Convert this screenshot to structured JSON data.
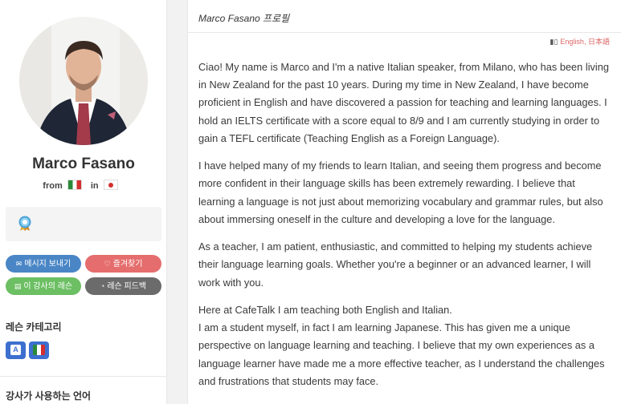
{
  "profile": {
    "name": "Marco Fasano",
    "from_label": "from",
    "in_label": "in",
    "from_flag": "italy-flag",
    "in_flag": "japan-flag"
  },
  "buttons": {
    "message": "메시지 보내기",
    "favorite": "즐겨찾기",
    "lessons": "이 강사의 레슨",
    "feedback": "레슨 피드백"
  },
  "sidebar": {
    "category_heading": "레슨 카테고리",
    "languages_heading": "강사가 사용하는 언어",
    "category_icons": [
      "english-category-icon",
      "italian-category-icon"
    ],
    "english_glyph": "A"
  },
  "main": {
    "title": "Marco Fasano 프로필",
    "language_links": [
      "English",
      "日本語"
    ],
    "language_separator": ",",
    "paragraphs": [
      "Ciao! My name is Marco and I'm a native Italian speaker, from Milano, who has been living in New Zealand for the past 10 years. During my time in New Zealand, I have become proficient in English and have discovered a passion for teaching and learning languages. I hold an IELTS certificate with a score equal to 8/9 and I am currently studying in order to gain a TEFL certificate (Teaching English as a Foreign Language).",
      "I have helped many of my friends to learn Italian, and seeing them progress and become more confident in their language skills has been extremely rewarding. I believe that learning a language is not just about memorizing vocabulary and grammar rules, but also about immersing oneself in the culture and developing a love for the language.",
      "As a teacher, I am patient, enthusiastic, and committed to helping my students achieve their language learning goals. Whether you're a beginner or an advanced learner, I will work with you."
    ],
    "paragraph4_line1": "Here at CafeTalk I am teaching both English and Italian.",
    "paragraph4_line2": "I am a student myself, in fact I am learning Japanese. This has given me a unique perspective on language learning and teaching. I believe that my own experiences as a language learner have made me a more effective teacher, as I understand the challenges and frustrations that students may face."
  },
  "colors": {
    "message_button": "#4a86c6",
    "favorite_button": "#e56d6d",
    "lessons_button": "#6cbf63",
    "feedback_button": "#6b6b6b",
    "link_accent": "#dd6666"
  }
}
